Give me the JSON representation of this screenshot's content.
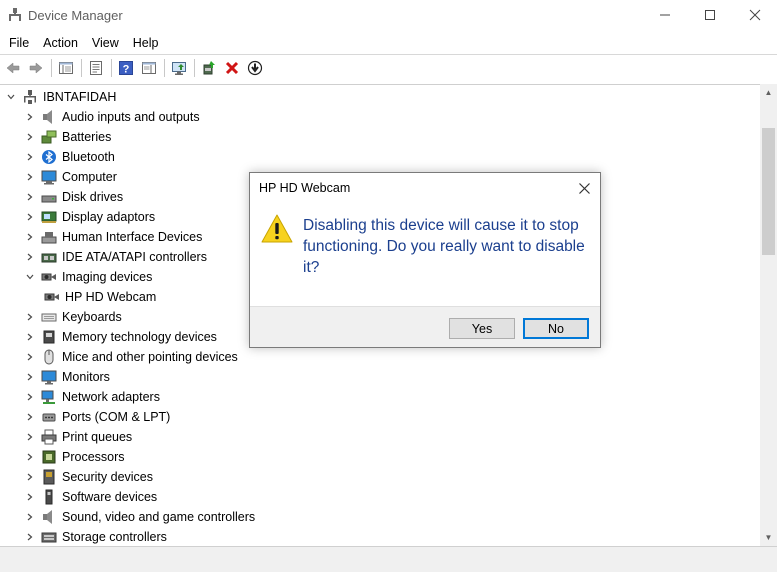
{
  "window": {
    "title": "Device Manager"
  },
  "menu": [
    "File",
    "Action",
    "View",
    "Help"
  ],
  "toolbar": {
    "buttons": [
      "back-icon",
      "forward-icon",
      "properties-icon",
      "show-hidden-icon",
      "help-icon",
      "update-driver-icon",
      "scan-hardware-icon",
      "enable-device-icon",
      "uninstall-icon",
      "disable-device-icon"
    ]
  },
  "tree": {
    "root": "IBNTAFIDAH",
    "items": [
      {
        "label": "Audio inputs and outputs",
        "icon": "speaker-icon",
        "expanded": false
      },
      {
        "label": "Batteries",
        "icon": "battery-icon",
        "expanded": false
      },
      {
        "label": "Bluetooth",
        "icon": "bluetooth-icon",
        "expanded": false
      },
      {
        "label": "Computer",
        "icon": "computer-icon",
        "expanded": false
      },
      {
        "label": "Disk drives",
        "icon": "disk-drive-icon",
        "expanded": false
      },
      {
        "label": "Display adaptors",
        "icon": "display-adapter-icon",
        "expanded": false
      },
      {
        "label": "Human Interface Devices",
        "icon": "hid-icon",
        "expanded": false
      },
      {
        "label": "IDE ATA/ATAPI controllers",
        "icon": "ide-controller-icon",
        "expanded": false
      },
      {
        "label": "Imaging devices",
        "icon": "camera-icon",
        "expanded": true
      },
      {
        "label": "HP HD Webcam",
        "icon": "webcam-icon",
        "child": true
      },
      {
        "label": "Keyboards",
        "icon": "keyboard-icon",
        "expanded": false
      },
      {
        "label": "Memory technology devices",
        "icon": "memory-icon",
        "expanded": false
      },
      {
        "label": "Mice and other pointing devices",
        "icon": "mouse-icon",
        "expanded": false
      },
      {
        "label": "Monitors",
        "icon": "monitor-icon",
        "expanded": false
      },
      {
        "label": "Network adapters",
        "icon": "network-adapter-icon",
        "expanded": false
      },
      {
        "label": "Ports (COM & LPT)",
        "icon": "port-icon",
        "expanded": false
      },
      {
        "label": "Print queues",
        "icon": "printer-icon",
        "expanded": false
      },
      {
        "label": "Processors",
        "icon": "processor-icon",
        "expanded": false
      },
      {
        "label": "Security devices",
        "icon": "security-device-icon",
        "expanded": false
      },
      {
        "label": "Software devices",
        "icon": "software-device-icon",
        "expanded": false
      },
      {
        "label": "Sound, video and game controllers",
        "icon": "sound-icon",
        "expanded": false
      },
      {
        "label": "Storage controllers",
        "icon": "storage-controller-icon",
        "expanded": false
      }
    ]
  },
  "dialog": {
    "title": "HP HD Webcam",
    "message": "Disabling this device will cause it to stop functioning. Do you really want to disable it?",
    "yes_label": "Yes",
    "no_label": "No"
  },
  "colors": {
    "message_text": "#1b3f8e",
    "warning_yellow": "#f7d21e",
    "focus_blue": "#0078d7"
  }
}
